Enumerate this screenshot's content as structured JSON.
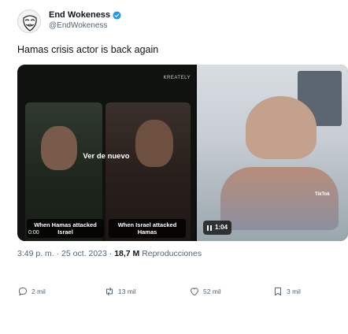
{
  "author": {
    "display_name": "End Wokeness",
    "handle": "@EndWokeness",
    "verified": true,
    "avatar_icon": "anonymous-mask-avatar"
  },
  "tweet": {
    "text": "Hamas crisis actor is back again"
  },
  "media": {
    "watermark": "KREATELY",
    "see_again_label": "Ver de nuevo",
    "caption_left": "When Hamas attacked Israel",
    "caption_right": "When Israel attacked Hamas",
    "left_video_time": "0:00",
    "play_time": "1:04",
    "tiktok_label": "TikTok"
  },
  "meta": {
    "time": "3:49 p. m.",
    "separator": "·",
    "date": "25 oct. 2023",
    "views_count": "18,7 M",
    "views_label": "Reproducciones"
  },
  "actions": {
    "replies": "2 mil",
    "reposts": "13 mil",
    "likes": "52 mil",
    "bookmarks": "3 mil"
  },
  "colors": {
    "text_primary": "#0f1419",
    "text_secondary": "#536471",
    "verified_blue": "#1d9bf0"
  }
}
